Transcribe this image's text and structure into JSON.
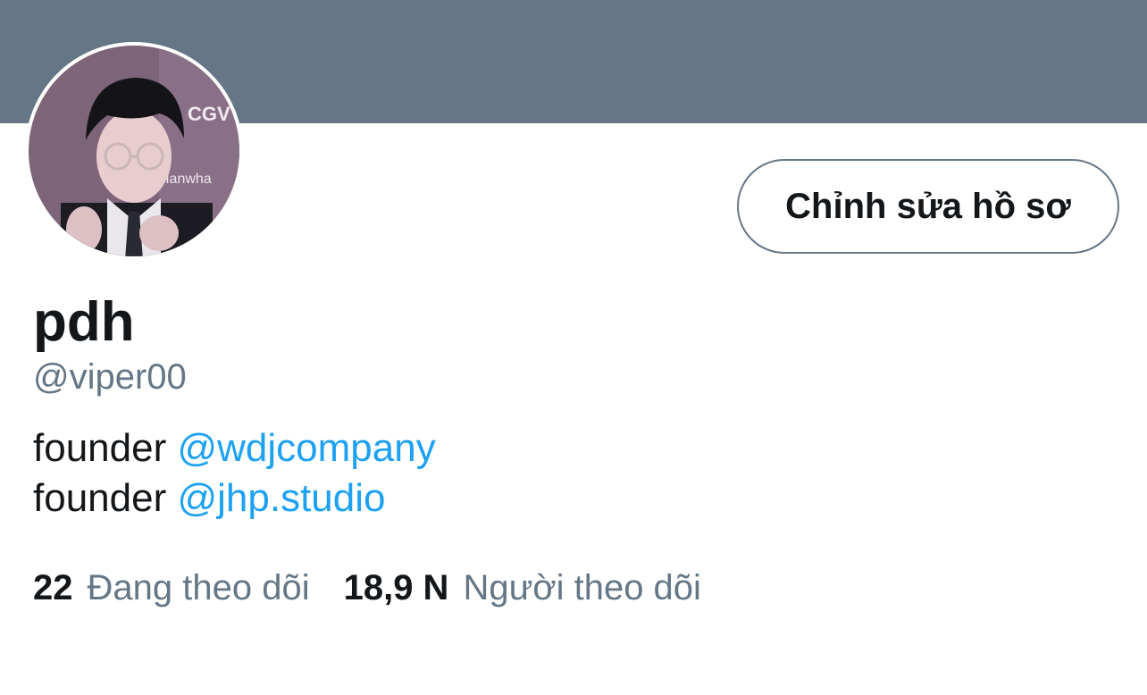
{
  "profile": {
    "display_name": "pdh",
    "handle": "@viper00",
    "edit_button_label": "Chỉnh sửa hồ sơ",
    "avatar_icon": "profile-photo",
    "banner_color": "#657686",
    "bio": [
      {
        "prefix": "founder ",
        "mention": "@wdjcompany"
      },
      {
        "prefix": "founder ",
        "mention": "@jhp.studio"
      }
    ],
    "stats": {
      "following_count": "22",
      "following_label": "Đang theo dõi",
      "followers_count": "18,9 N",
      "followers_label": "Người theo dõi"
    }
  },
  "colors": {
    "text_primary": "#14171a",
    "text_secondary": "#657786",
    "link": "#1da1f2"
  }
}
